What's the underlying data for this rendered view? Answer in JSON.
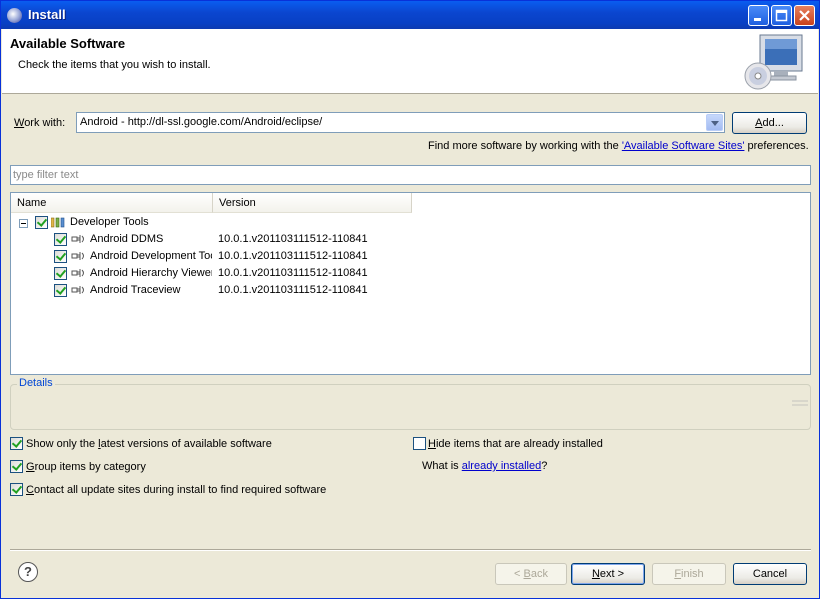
{
  "window": {
    "title": "Install"
  },
  "banner": {
    "title": "Available Software",
    "description": "Check the items that you wish to install."
  },
  "work_with": {
    "label_prefix": "W",
    "label_rest": "ork with:",
    "value": "Android - http://dl-ssl.google.com/Android/eclipse/",
    "add_label_u": "A",
    "add_label_rest": "dd..."
  },
  "find_more": {
    "prefix": "Find more software by working with the ",
    "link": "'Available Software Sites'",
    "suffix": " preferences."
  },
  "filter": {
    "placeholder": "type filter text"
  },
  "tree": {
    "columns": [
      "Name",
      "Version"
    ],
    "category": "Developer Tools",
    "items": [
      {
        "name": "Android DDMS",
        "version": "10.0.1.v201103111512-110841"
      },
      {
        "name": "Android Development Toc",
        "version": "10.0.1.v201103111512-110841"
      },
      {
        "name": "Android Hierarchy Viewer",
        "version": "10.0.1.v201103111512-110841"
      },
      {
        "name": "Android Traceview",
        "version": "10.0.1.v201103111512-110841"
      }
    ]
  },
  "details": {
    "label": "Details"
  },
  "options": {
    "latest_pre": "Show only the ",
    "latest_u": "l",
    "latest_rest": "atest versions of available software",
    "group_u": "G",
    "group_rest": "roup items by category",
    "contact_u": "C",
    "contact_rest": "ontact all update sites during install to find required software",
    "hide_u": "H",
    "hide_rest": "ide items that are already installed",
    "what_is": "What is ",
    "already_installed": "already installed",
    "question": "?"
  },
  "buttons": {
    "back_pre": "< ",
    "back_u": "B",
    "back_rest": "ack",
    "next_u": "N",
    "next_rest": "ext >",
    "finish_u": "F",
    "finish_rest": "inish",
    "cancel": "Cancel"
  },
  "help_glyph": "?",
  "colors": {
    "titlebar": "#0a5df0",
    "link": "#0000cc",
    "dialog": "#ece9d8"
  }
}
